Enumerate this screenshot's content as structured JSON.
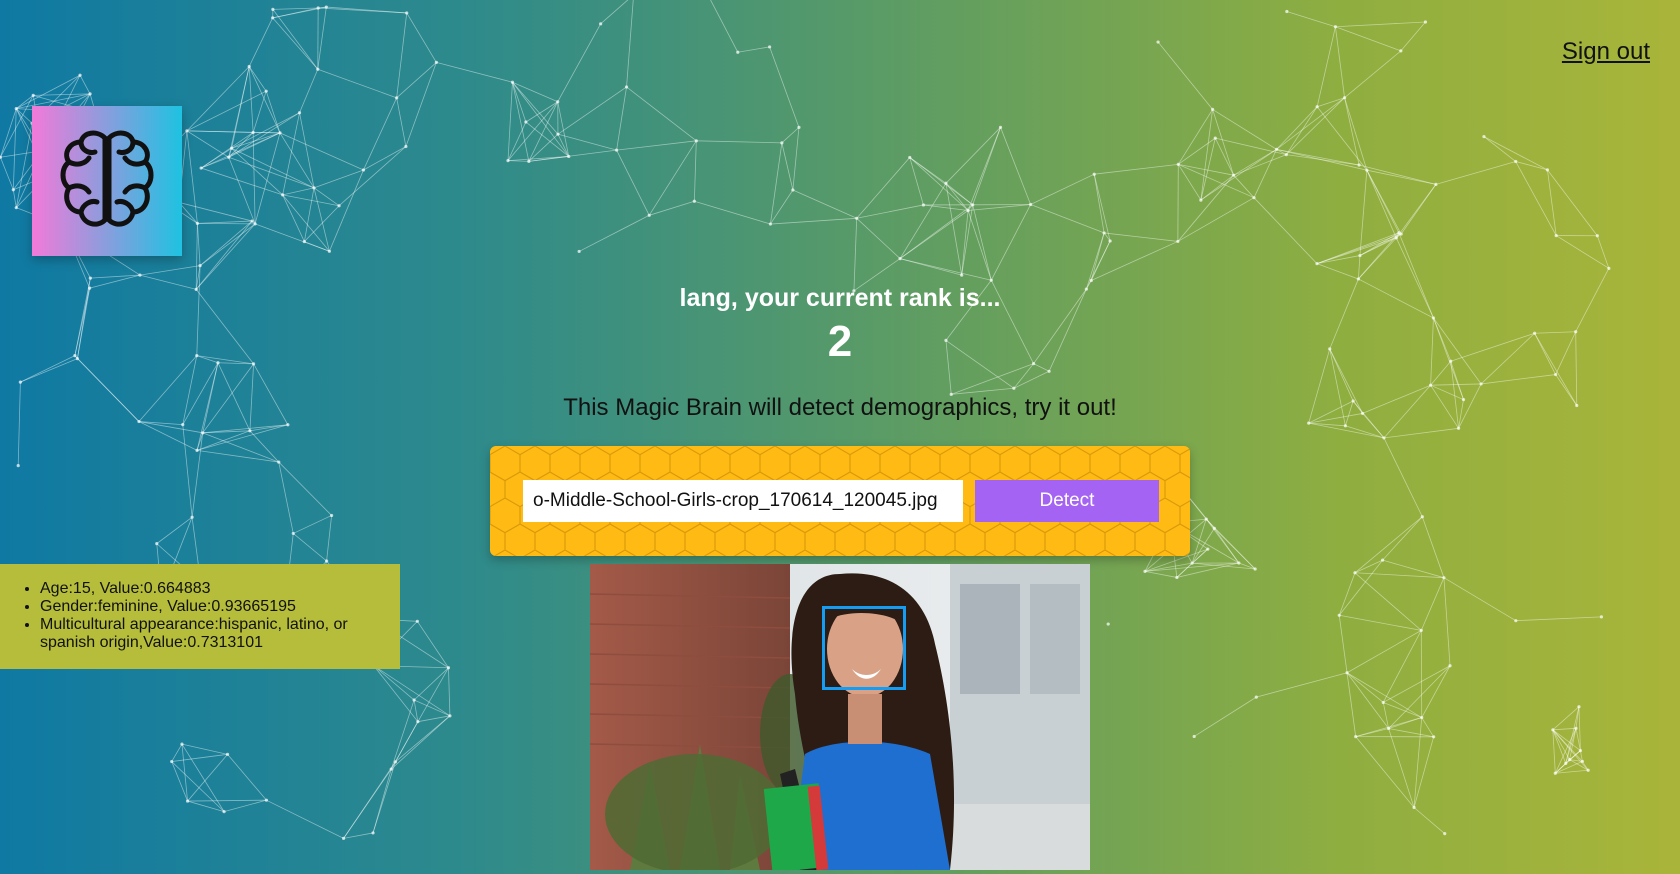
{
  "header": {
    "signout_label": "Sign out"
  },
  "logo": {
    "icon": "brain-icon"
  },
  "rank": {
    "text": "lang, your current rank is...",
    "value": "2"
  },
  "intro": {
    "text": "This Magic Brain will detect demographics, try it out!"
  },
  "form": {
    "input_value": "o-Middle-School-Girls-crop_170614_120045.jpg",
    "detect_label": "Detect"
  },
  "results": {
    "items": [
      "Age:15, Value:0.664883",
      "Gender:feminine, Value:0.93665195",
      "Multicultural appearance:hispanic, latino, or spanish origin,Value:0.7313101"
    ]
  },
  "colors": {
    "form_background": "#ffbb14",
    "detect_button": "#a463f2",
    "results_background": "#b5bd3b",
    "face_box": "#149df2"
  }
}
